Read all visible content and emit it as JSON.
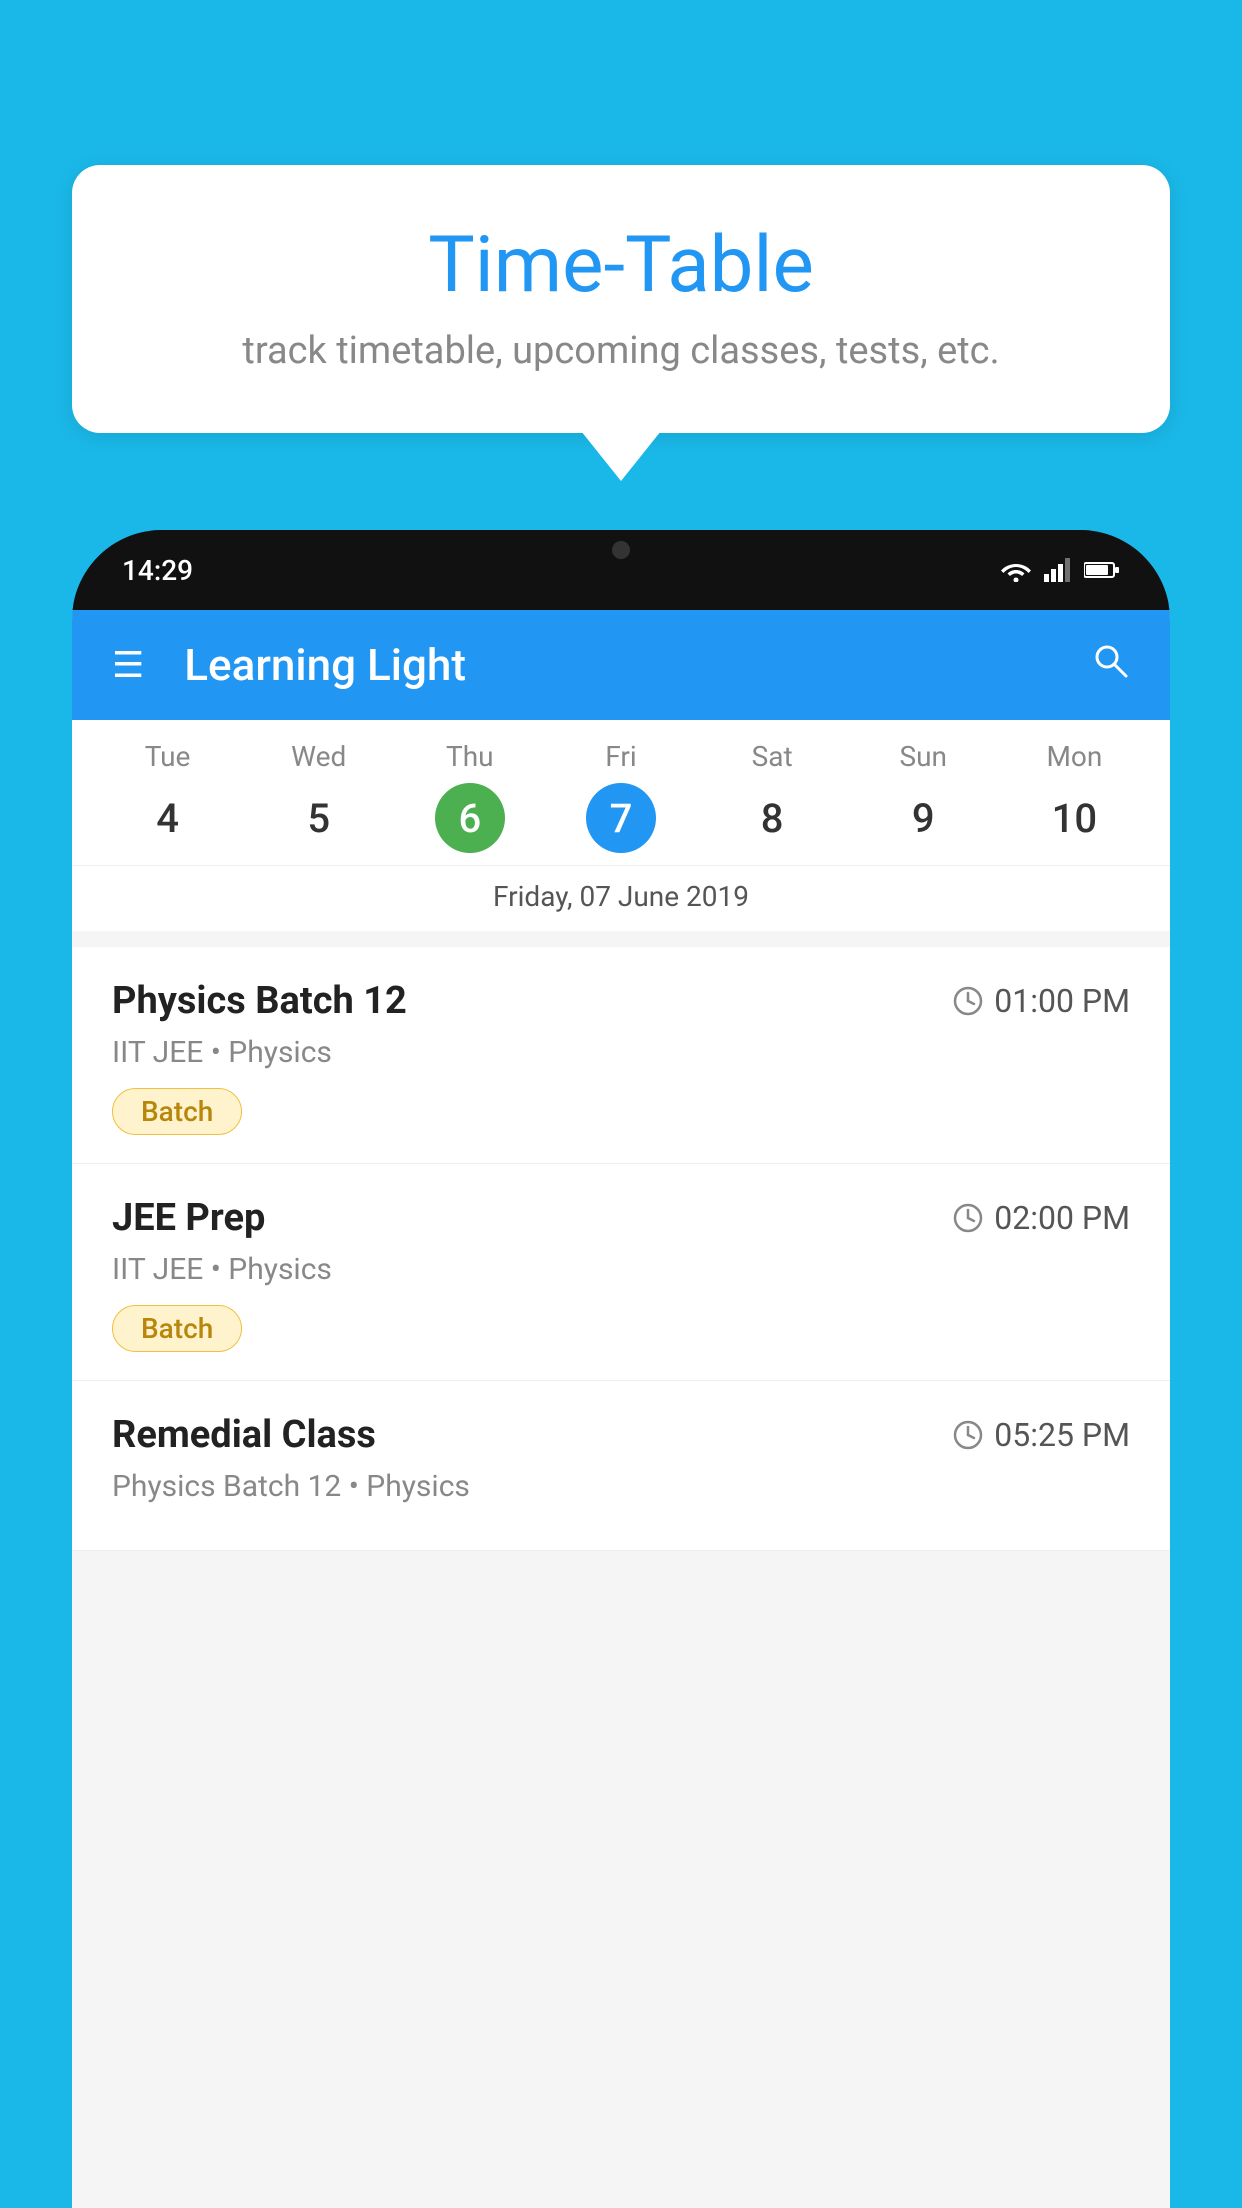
{
  "background_color": "#1ab8e8",
  "bubble": {
    "title": "Time-Table",
    "subtitle": "track timetable, upcoming classes, tests, etc."
  },
  "status_bar": {
    "time": "14:29",
    "icons": [
      "wifi",
      "signal",
      "battery"
    ]
  },
  "app_bar": {
    "title": "Learning Light",
    "menu_icon": "☰",
    "search_icon": "🔍"
  },
  "calendar": {
    "days": [
      {
        "name": "Tue",
        "num": "4",
        "state": "normal"
      },
      {
        "name": "Wed",
        "num": "5",
        "state": "normal"
      },
      {
        "name": "Thu",
        "num": "6",
        "state": "today"
      },
      {
        "name": "Fri",
        "num": "7",
        "state": "selected"
      },
      {
        "name": "Sat",
        "num": "8",
        "state": "normal"
      },
      {
        "name": "Sun",
        "num": "9",
        "state": "normal"
      },
      {
        "name": "Mon",
        "num": "10",
        "state": "normal"
      }
    ],
    "selected_date_label": "Friday, 07 June 2019"
  },
  "schedule_items": [
    {
      "title": "Physics Batch 12",
      "time": "01:00 PM",
      "subtitle": "IIT JEE • Physics",
      "badge": "Batch"
    },
    {
      "title": "JEE Prep",
      "time": "02:00 PM",
      "subtitle": "IIT JEE • Physics",
      "badge": "Batch"
    },
    {
      "title": "Remedial Class",
      "time": "05:25 PM",
      "subtitle": "Physics Batch 12 • Physics",
      "badge": null
    }
  ]
}
